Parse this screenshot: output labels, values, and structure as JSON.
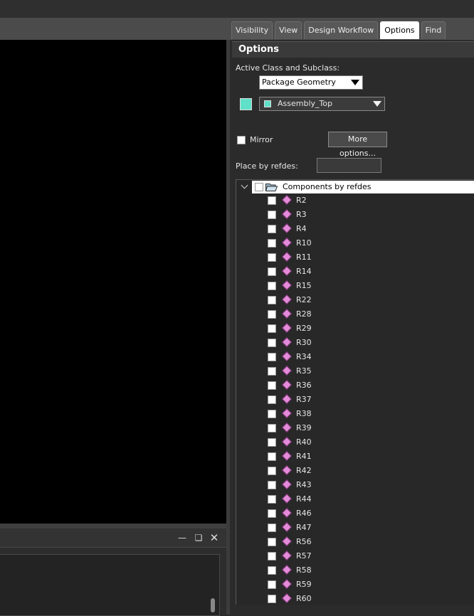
{
  "tabs": [
    "Visibility",
    "View",
    "Design Workflow",
    "Options",
    "Find"
  ],
  "active_tab": "Options",
  "panel": {
    "title": "Options",
    "active_class_label": "Active Class and Subclass:",
    "class_value": "Package Geometry",
    "subclass_value": "Assembly_Top",
    "subclass_color": "#5fe0c8",
    "mirror_label": "Mirror",
    "mirror_checked": false,
    "more_options_label": "More options...",
    "place_by_refdes_label": "Place by refdes:",
    "place_by_refdes_value": ""
  },
  "tree": {
    "root_label": "Components by refdes",
    "items": [
      "R2",
      "R3",
      "R4",
      "R10",
      "R11",
      "R14",
      "R15",
      "R22",
      "R28",
      "R29",
      "R30",
      "R34",
      "R35",
      "R36",
      "R37",
      "R38",
      "R39",
      "R40",
      "R41",
      "R42",
      "R43",
      "R44",
      "R46",
      "R47",
      "R56",
      "R57",
      "R58",
      "R59",
      "R60"
    ],
    "component_color": "#e38ad9"
  },
  "console": {
    "minimize_icon": "minimize-icon",
    "restore_icon": "restore-icon",
    "close_icon": "close-icon"
  },
  "colors": {
    "canvas_background": "#000000",
    "panel_background": "#2b2b2b",
    "active_tab_background": "#ffffff"
  }
}
